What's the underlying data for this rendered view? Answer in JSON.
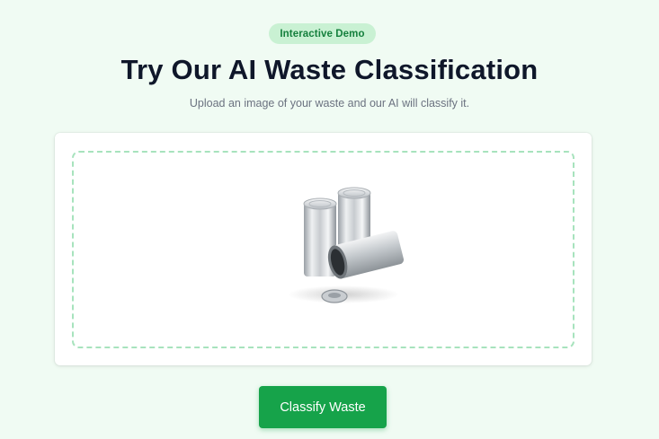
{
  "badge": {
    "label": "Interactive Demo"
  },
  "hero": {
    "title": "Try Our AI Waste Classification",
    "subtitle": "Upload an image of your waste and our AI will classify it."
  },
  "upload": {
    "preview_icon": "aluminum-cans-image"
  },
  "actions": {
    "classify_label": "Classify Waste"
  },
  "colors": {
    "background": "#f0fbf3",
    "accent": "#16a34a",
    "badge_bg": "#c9f1d3",
    "badge_text": "#15803d",
    "dropzone_border": "#a7e3bd"
  }
}
